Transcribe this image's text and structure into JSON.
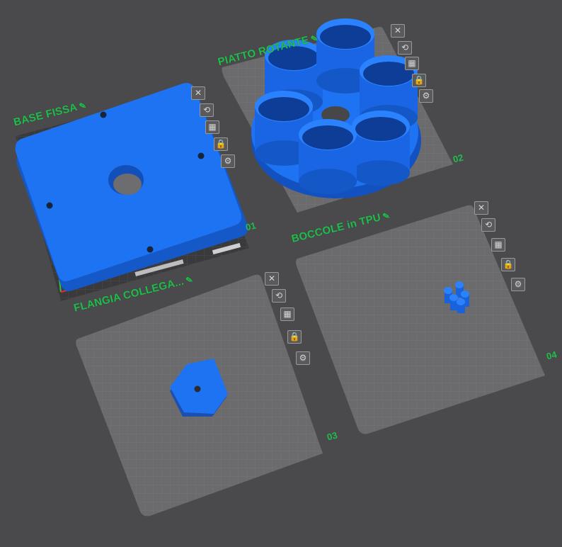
{
  "plates": [
    {
      "id": "plate-1",
      "name": "BASE FISSA",
      "number": "01"
    },
    {
      "id": "plate-2",
      "name": "PIATTO ROTANTE",
      "number": "02"
    },
    {
      "id": "plate-3",
      "name": "FLANGIA COLLEGA...",
      "number": "03"
    },
    {
      "id": "plate-4",
      "name": "BOCCOLE in TPU",
      "number": "04"
    }
  ],
  "plate_tools": [
    "close-icon",
    "auto-orient-icon",
    "arrange-icon",
    "lock-icon",
    "settings-gear-icon"
  ],
  "edit_icon": "pencil-icon",
  "colors": {
    "background": "#4a4a4c",
    "label_green": "#1fbe4b",
    "model_blue": "#1e6ff0",
    "plate_fill": "#6b6b6d",
    "plate_grid": "#7e7e80"
  }
}
